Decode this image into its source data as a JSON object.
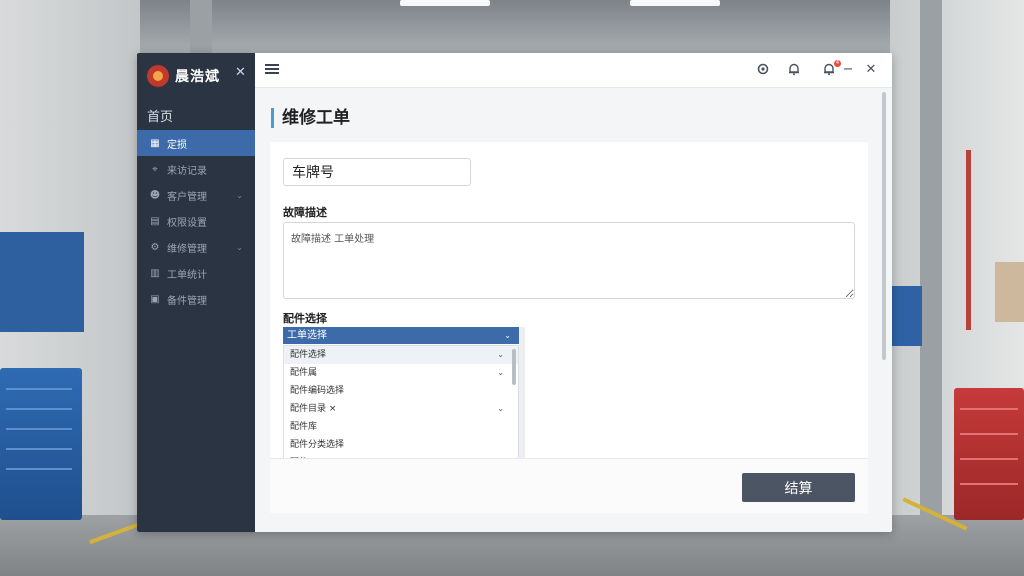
{
  "sidebar": {
    "brand": "晨浩斌",
    "home": "首页",
    "items": [
      {
        "label": "定损",
        "icon": "grid-icon",
        "active": true,
        "chevron": false
      },
      {
        "label": "来访记录",
        "icon": "location-icon",
        "active": false,
        "chevron": false
      },
      {
        "label": "客户管理",
        "icon": "user-icon",
        "active": false,
        "chevron": true
      },
      {
        "label": "权限设置",
        "icon": "clipboard-icon",
        "active": false,
        "chevron": false
      },
      {
        "label": "维修管理",
        "icon": "gear-icon",
        "active": false,
        "chevron": true
      },
      {
        "label": "工单统计",
        "icon": "chart-icon",
        "active": false,
        "chevron": false
      },
      {
        "label": "备件管理",
        "icon": "box-icon",
        "active": false,
        "chevron": false
      }
    ]
  },
  "topbar": {
    "notification_badge": "4"
  },
  "main": {
    "title": "维修工单",
    "plate_field": {
      "value": "车牌号"
    },
    "fault_label": "故障描述",
    "fault_field": {
      "value": "故障描述 工单处理"
    },
    "parts_label": "配件选择",
    "parts_select": {
      "value": "工单选择"
    },
    "parts_options": [
      {
        "label": "配件选择",
        "chevron": true,
        "highlight": true
      },
      {
        "label": "配件属",
        "chevron": true,
        "highlight": false
      },
      {
        "label": "配件编码选择",
        "chevron": false,
        "highlight": false
      },
      {
        "label": "配件目录 ×",
        "chevron": true,
        "highlight": false
      },
      {
        "label": "配件库",
        "chevron": false,
        "highlight": false
      },
      {
        "label": "配件分类选择",
        "chevron": false,
        "highlight": false
      },
      {
        "label": "配件",
        "chevron": false,
        "highlight": false
      }
    ],
    "checkout_label": "结算"
  },
  "colors": {
    "sidebar_bg": "#2b3442",
    "accent": "#3d6aa8",
    "title_bar": "#4d9bd6",
    "checkout_btn": "#4b5563",
    "badge": "#e74c3c"
  }
}
